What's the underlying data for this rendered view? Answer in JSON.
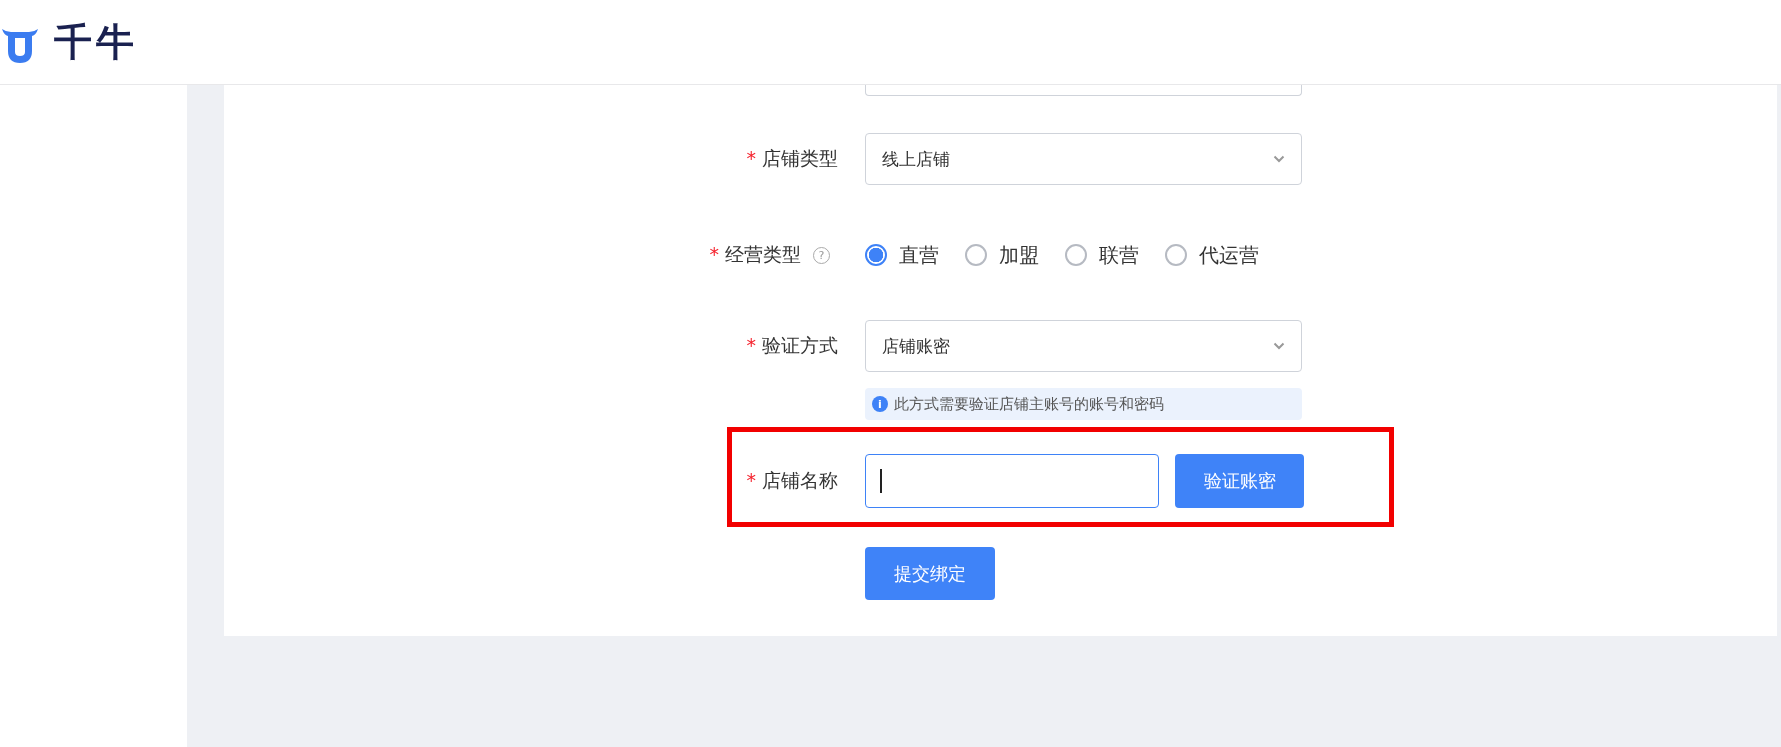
{
  "header": {
    "logo_text": "千牛"
  },
  "form": {
    "required_mark": "*",
    "fields": [
      {
        "kind": "select",
        "label": "店铺类型",
        "required": true,
        "value": "线上店铺"
      },
      {
        "kind": "radio",
        "label": "经营类型",
        "required": true,
        "help_icon": "?",
        "options": [
          {
            "label": "直营",
            "selected": true
          },
          {
            "label": "加盟",
            "selected": false
          },
          {
            "label": "联营",
            "selected": false
          },
          {
            "label": "代运营",
            "selected": false
          }
        ]
      },
      {
        "kind": "select",
        "label": "验证方式",
        "required": true,
        "value": "店铺账密",
        "hint": {
          "icon": "i",
          "text": "此方式需要验证店铺主账号的账号和密码"
        }
      },
      {
        "kind": "input",
        "label": "店铺名称",
        "required": true,
        "focused": true,
        "highlighted": true,
        "button": "验证账密"
      }
    ],
    "submit_button": "提交绑定"
  }
}
